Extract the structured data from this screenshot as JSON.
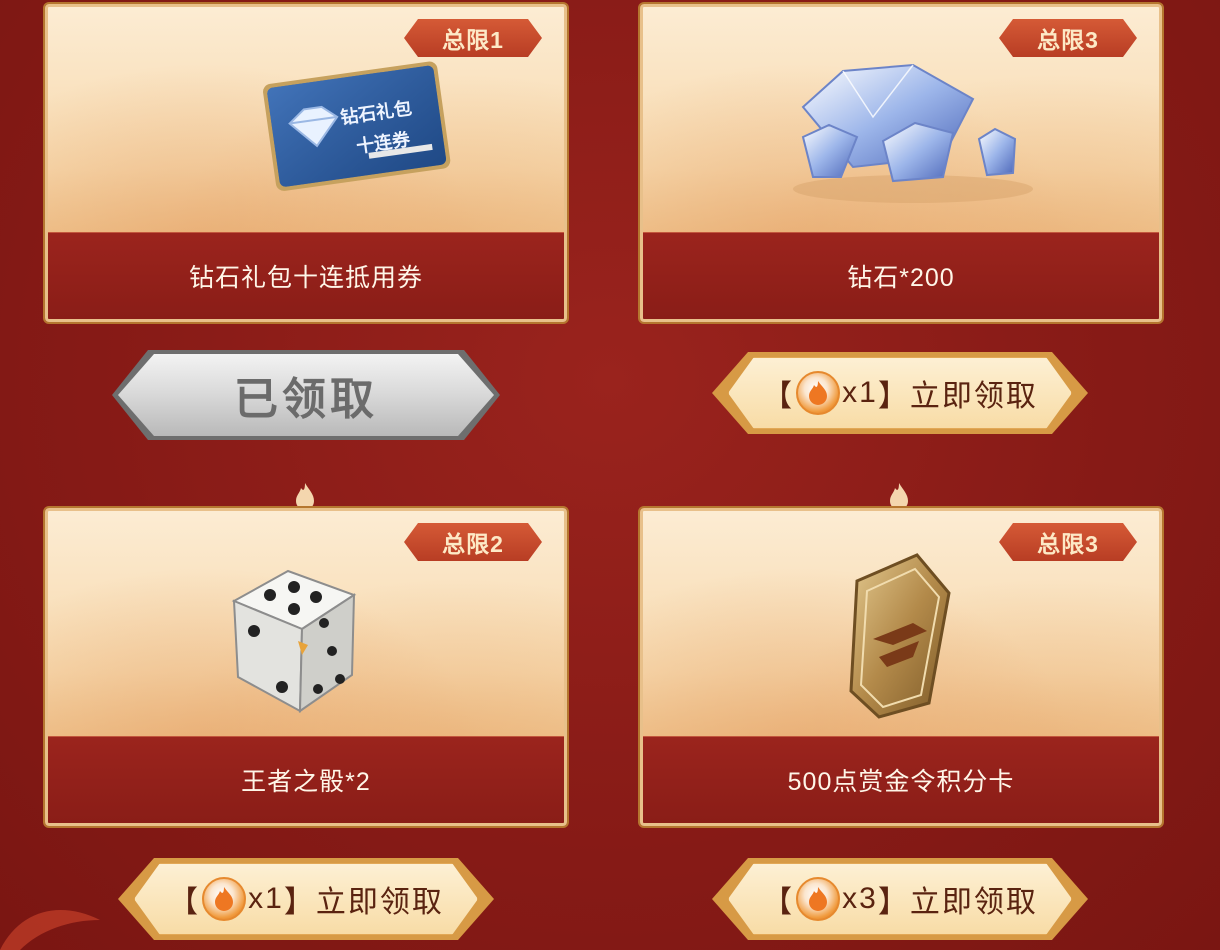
{
  "cards": [
    {
      "name": "钻石礼包十连抵用券",
      "limit": "总限1",
      "item_icon": "diamond-voucher-icon",
      "ticket_text_1": "钻石礼包",
      "ticket_text_2": "十连券"
    },
    {
      "name": "钻石*200",
      "limit": "总限3",
      "item_icon": "diamond-pile-icon"
    },
    {
      "name": "王者之骰*2",
      "limit": "总限2",
      "item_icon": "dice-icon"
    },
    {
      "name": "500点赏金令积分卡",
      "limit": "总限3",
      "item_icon": "cf-badge-icon"
    }
  ],
  "buttons": [
    {
      "label": "已领取",
      "state": "claimed"
    },
    {
      "open_bracket": "【",
      "cost": "x1",
      "close_bracket": "】",
      "action": "立即领取",
      "state": "available"
    },
    {
      "open_bracket": "【",
      "cost": "x1",
      "close_bracket": "】",
      "action": "立即领取",
      "state": "available"
    },
    {
      "open_bracket": "【",
      "cost": "x3",
      "close_bracket": "】",
      "action": "立即领取",
      "state": "available"
    }
  ],
  "colors": {
    "background": "#8e1c18",
    "card_band": "#9b241d",
    "limit_tag": "#c44a2c",
    "gold_button": "#fbe3b3",
    "claimed_button": "#d8d8d8"
  }
}
